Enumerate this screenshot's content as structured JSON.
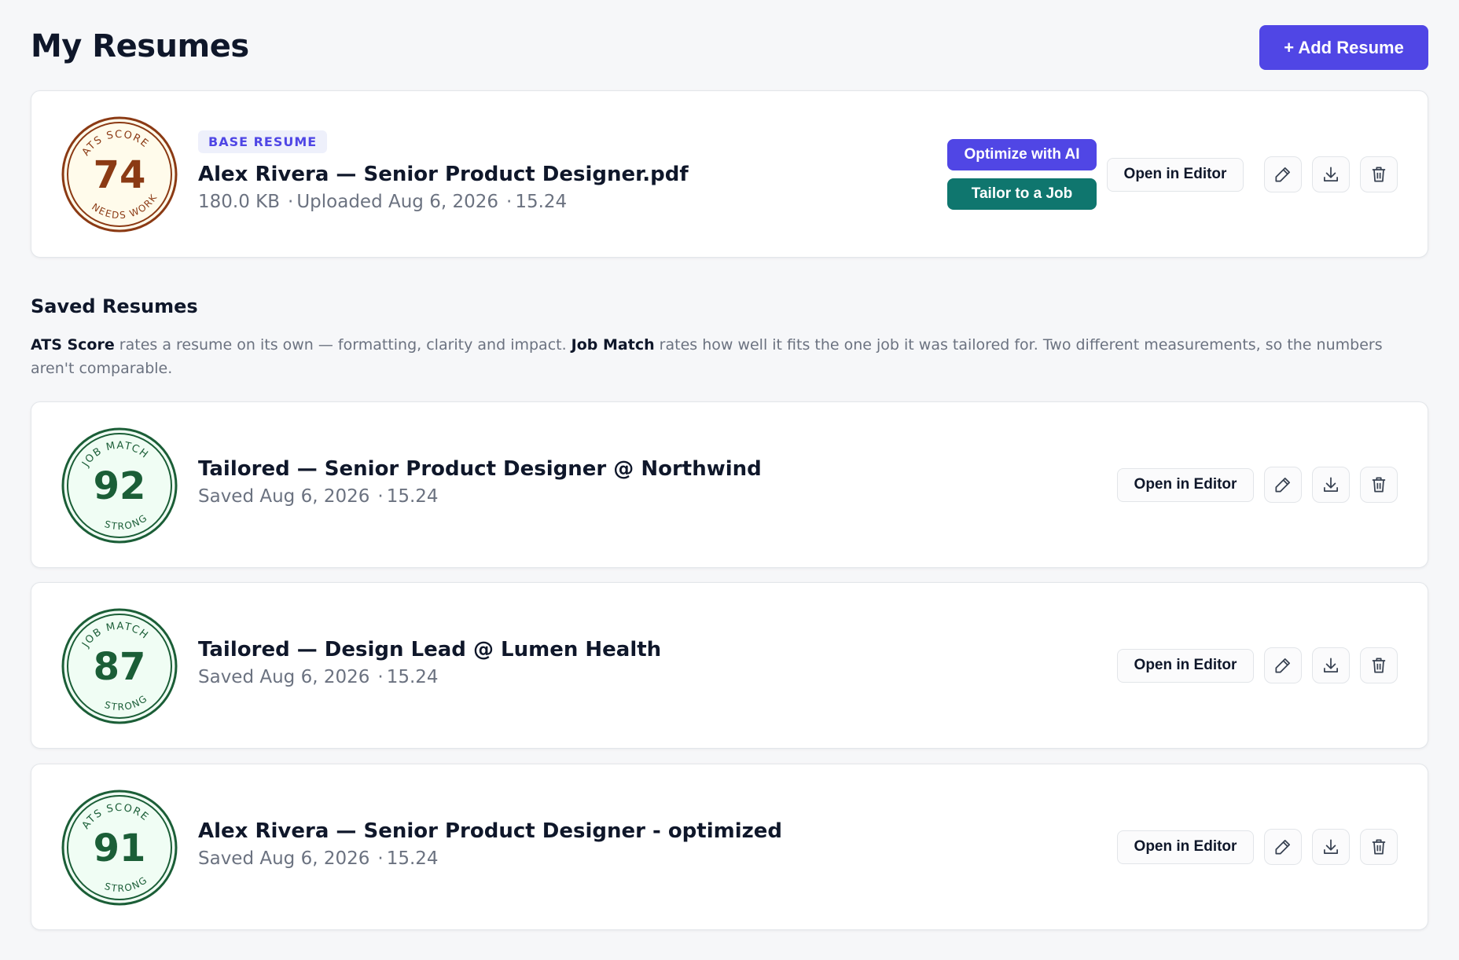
{
  "header": {
    "title": "My Resumes",
    "add_button": "+ Add Resume"
  },
  "base_resume": {
    "badge": {
      "top": "ATS SCORE",
      "score": "74",
      "bottom": "NEEDS WORK",
      "ring": "#8b3a14",
      "fill": "#fffbeb"
    },
    "pill": "BASE RESUME",
    "title": "Alex Rivera — Senior Product Designer.pdf",
    "size": "180.0 KB",
    "uploaded": "Uploaded Aug 6, 2026",
    "time": "15.24",
    "optimize_button": "Optimize with AI",
    "tailor_button": "Tailor to a Job",
    "editor_button": "Open in Editor"
  },
  "saved": {
    "title": "Saved Resumes",
    "explain": {
      "ats_term": "ATS Score",
      "ats_text": " rates a resume on its own — formatting, clarity and impact. ",
      "match_term": "Job Match",
      "match_text": " rates how well it fits the one job it was tailored for. Two different measurements, so the numbers aren't comparable."
    },
    "items": [
      {
        "badge": {
          "top": "JOB MATCH",
          "score": "92",
          "bottom": "STRONG",
          "ring": "#1b5e37",
          "fill": "#f0fdf4"
        },
        "title": "Tailored — Senior Product Designer @ Northwind",
        "saved": "Saved Aug 6, 2026",
        "time": "15.24",
        "editor_button": "Open in Editor"
      },
      {
        "badge": {
          "top": "JOB MATCH",
          "score": "87",
          "bottom": "STRONG",
          "ring": "#1b5e37",
          "fill": "#f0fdf4"
        },
        "title": "Tailored — Design Lead @ Lumen Health",
        "saved": "Saved Aug 6, 2026",
        "time": "15.24",
        "editor_button": "Open in Editor"
      },
      {
        "badge": {
          "top": "ATS SCORE",
          "score": "91",
          "bottom": "STRONG",
          "ring": "#1b5e37",
          "fill": "#f0fdf4"
        },
        "title": "Alex Rivera — Senior Product Designer - optimized",
        "saved": "Saved Aug 6, 2026",
        "time": "15.24",
        "editor_button": "Open in Editor"
      }
    ]
  },
  "icons": {
    "edit": "pencil-icon",
    "download": "download-icon",
    "delete": "trash-icon"
  }
}
